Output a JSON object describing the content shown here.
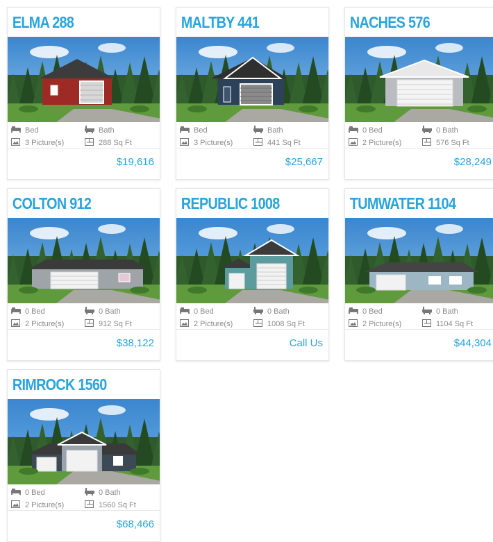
{
  "listings": [
    {
      "name": "ELMA 288",
      "bed": "Bed",
      "bath": "Bath",
      "pictures": "3 Picture(s)",
      "sqft": "288 Sq Ft",
      "price": "$19,616",
      "body_color": "#9e2a25",
      "roof_color": "#3c3c3c",
      "trim_color": "#ffffff",
      "sky": "#8fc3ea"
    },
    {
      "name": "MALTBY 441",
      "bed": "Bed",
      "bath": "Bath",
      "pictures": "3 Picture(s)",
      "sqft": "441 Sq Ft",
      "price": "$25,667",
      "body_color": "#2d4159",
      "roof_color": "#2f2f2f",
      "trim_color": "#ffffff",
      "sky": "#8fc3ea"
    },
    {
      "name": "NACHES 576",
      "bed": "0 Bed",
      "bath": "0 Bath",
      "pictures": "2 Picture(s)",
      "sqft": "576 Sq Ft",
      "price": "$28,249",
      "body_color": "#b9bcc0",
      "roof_color": "#e8e8e8",
      "trim_color": "#ffffff",
      "sky": "#7fb8e3"
    },
    {
      "name": "COLTON 912",
      "bed": "0 Bed",
      "bath": "0 Bath",
      "pictures": "2 Picture(s)",
      "sqft": "912 Sq Ft",
      "price": "$38,122",
      "body_color": "#9fa4a8",
      "roof_color": "#3b3b3b",
      "trim_color": "#ffffff",
      "sky": "#7fb8e3"
    },
    {
      "name": "REPUBLIC 1008",
      "bed": "0 Bed",
      "bath": "0 Bath",
      "pictures": "2 Picture(s)",
      "sqft": "1008 Sq Ft",
      "price": "Call Us",
      "body_color": "#5d9c9e",
      "roof_color": "#3b3b3b",
      "trim_color": "#ffffff",
      "sky": "#6cb0e6"
    },
    {
      "name": "TUMWATER 1104",
      "bed": "0 Bed",
      "bath": "0 Bath",
      "pictures": "2 Picture(s)",
      "sqft": "1104 Sq Ft",
      "price": "$44,304",
      "body_color": "#9cb6c3",
      "roof_color": "#444444",
      "trim_color": "#ffffff",
      "sky": "#7fb8e3"
    },
    {
      "name": "RIMROCK 1560",
      "bed": "0 Bed",
      "bath": "0 Bath",
      "pictures": "2 Picture(s)",
      "sqft": "1560 Sq Ft",
      "price": "$68,466",
      "body_color": "#3b4a55",
      "roof_color": "#3a3a3a",
      "trim_color": "#ffffff",
      "sky": "#6cb0e6"
    }
  ],
  "icons": {
    "bed": "bed-icon",
    "bath": "bathtub-icon",
    "pictures": "picture-icon",
    "sqft": "floorplan-icon"
  },
  "accent_color": "#2aa4dc"
}
